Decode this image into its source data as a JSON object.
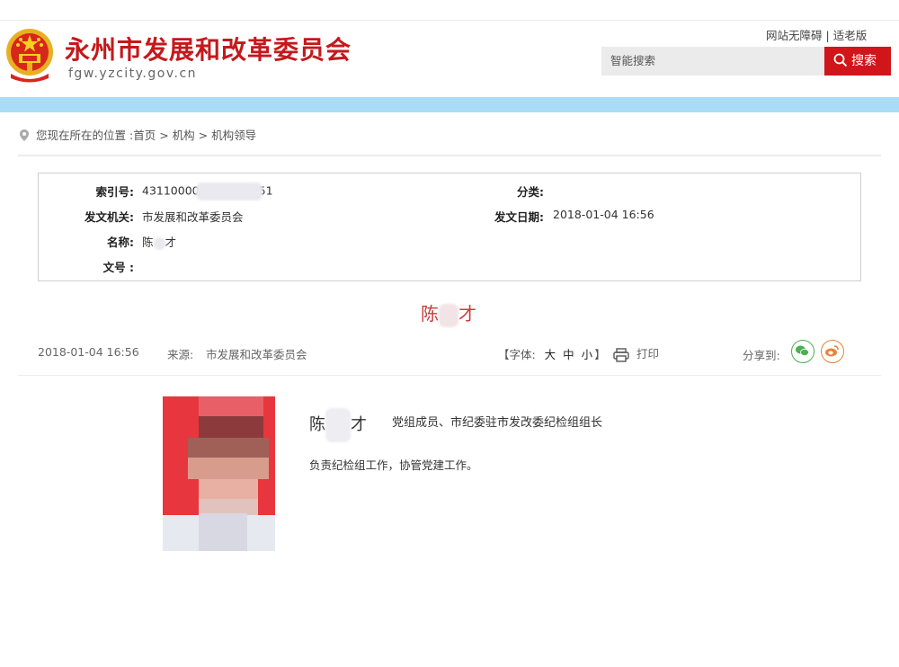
{
  "header": {
    "title": "永州市发展和改革委员会",
    "domain": "fgw.yzcity.gov.cn",
    "links": [
      "网站无障碍",
      "适老版"
    ],
    "link_separator": "|",
    "search_placeholder": "智能搜索",
    "search_button": "搜索"
  },
  "breadcrumb": {
    "prefix": "您现在所在的位置 :",
    "items": [
      "首页",
      "机构",
      "机构领导"
    ],
    "separator": ">"
  },
  "info": {
    "index_label": "索引号:",
    "index_value_start": "43110000",
    "index_value_end": "51",
    "category_label": "分类:",
    "category_value": "",
    "issuer_label": "发文机关:",
    "issuer_value": "市发展和改革委员会",
    "date_label": "发文日期:",
    "date_value": "2018-01-04 16:56",
    "name_label": "名称:",
    "name_first": "陈",
    "name_last": "才",
    "docno_label": "文号 :",
    "docno_value": ""
  },
  "article": {
    "title_first": "陈",
    "title_last": "才",
    "date": "2018-01-04 16:56",
    "source_label": "来源:",
    "source": "市发展和改革委员会",
    "font_size_label": "【字体:",
    "font_sizes": [
      "大",
      "中",
      "小"
    ],
    "font_size_close": "】",
    "print_label": "打印",
    "share_label": "分享到:"
  },
  "person": {
    "name_first": "陈",
    "name_last": "才",
    "role": "党组成员、市纪委驻市发改委纪检组组长",
    "duty": "负责纪检组工作，协管党建工作。"
  },
  "colors": {
    "brand_red": "#c4191c",
    "search_button": "#d0161a",
    "band_blue": "#a8ddf5",
    "title_red": "#c83a3a",
    "wechat_green": "#4caf50",
    "weibo_orange": "#e8833a"
  },
  "icons": [
    "national-emblem-icon",
    "search-icon",
    "location-pin-icon",
    "printer-icon",
    "wechat-icon",
    "weibo-icon"
  ]
}
